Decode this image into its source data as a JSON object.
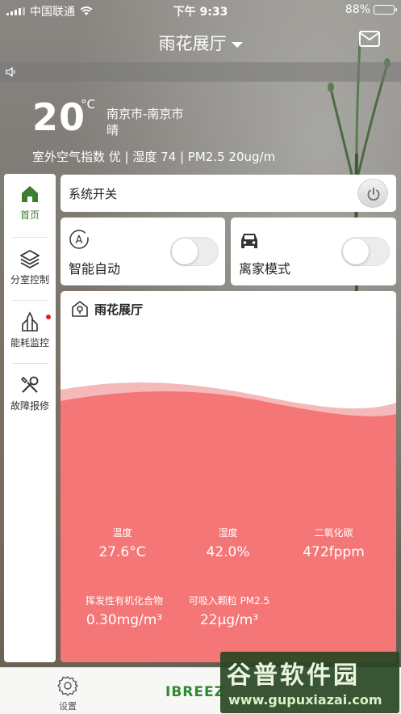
{
  "status_bar": {
    "carrier": "中国联通",
    "time": "下午 9:33",
    "battery": "88%",
    "battery_level": 0.88
  },
  "header": {
    "title": "雨花展厅",
    "icons": [
      "chevron-down-icon",
      "mail-icon"
    ]
  },
  "notice": {
    "icon": "speaker-icon"
  },
  "weather": {
    "temperature": "20",
    "unit": "°C",
    "city": "南京市-南京市",
    "condition": "晴",
    "summary": "室外空气指数 优 | 湿度 74 | PM2.5 20ug/m"
  },
  "sidebar": {
    "items": [
      {
        "label": "首页",
        "icon": "home-icon",
        "active": true
      },
      {
        "label": "分室控制",
        "icon": "layers-icon",
        "active": false
      },
      {
        "label": "能耗监控",
        "icon": "energy-icon",
        "active": false,
        "badge": true
      },
      {
        "label": "故障报修",
        "icon": "tools-icon",
        "active": false
      }
    ]
  },
  "system_switch": {
    "label": "系统开关",
    "icon": "power-icon"
  },
  "modes": [
    {
      "label": "智能自动",
      "icon": "auto-icon",
      "on": false
    },
    {
      "label": "离家模式",
      "icon": "car-icon",
      "on": false
    }
  ],
  "room": {
    "name": "雨花展厅",
    "icon": "location-home-icon",
    "wave_color": "#f47676",
    "metrics": [
      {
        "label": "温度",
        "value": "27.6°C"
      },
      {
        "label": "湿度",
        "value": "42.0%"
      },
      {
        "label": "二氧化碳",
        "value": "472fppm"
      },
      {
        "label": "挥发性有机化合物",
        "value": "0.30mg/m³"
      },
      {
        "label": "可吸入颗粒 PM2.5",
        "value": "22μg/m³"
      }
    ]
  },
  "bottom_bar": {
    "settings_label": "设置",
    "brand": "IBREEZ"
  },
  "watermark": {
    "title": "谷普软件园",
    "url": "www.gupuxiazai.com"
  },
  "colors": {
    "accent_green": "#3e7d2f",
    "wave": "#f47676",
    "badge_red": "#e02020"
  }
}
